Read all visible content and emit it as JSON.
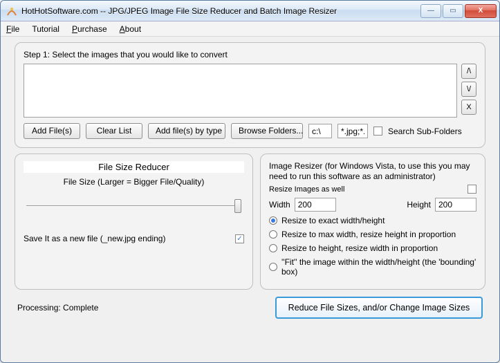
{
  "title": "HotHotSoftware.com -- JPG/JPEG Image File Size Reducer and Batch Image Resizer",
  "menu": {
    "file": "File",
    "tutorial": "Tutorial",
    "purchase": "Purchase",
    "about": "About"
  },
  "step1": {
    "label": "Step 1: Select the images that you would like to convert",
    "add_files": "Add File(s)",
    "clear_list": "Clear List",
    "add_by_type": "Add file(s) by type",
    "browse_folders": "Browse Folders...",
    "folder": "c:\\",
    "filter": "*.jpg;*.g",
    "search_sub": "Search Sub-Folders",
    "up": "/\\",
    "down": "\\/",
    "remove": "X"
  },
  "reducer": {
    "title": "File Size Reducer",
    "subtitle": "File Size (Larger = Bigger File/Quality)",
    "save_new": "Save It as a new file (_new.jpg ending)"
  },
  "resizer": {
    "note": "Image Resizer (for Windows Vista, to use this you may need to run this software as an administrator)",
    "also": "Resize Images as well",
    "width_lbl": "Width",
    "width": "200",
    "height_lbl": "Height",
    "height": "200",
    "r1": "Resize to exact width/height",
    "r2": "Resize to max width, resize height in proportion",
    "r3": "Resize to height, resize width in proportion",
    "r4": "''Fit'' the image within the width/height (the 'bounding' box)"
  },
  "status": "Processing: Complete",
  "go": "Reduce File Sizes, and/or Change Image Sizes"
}
